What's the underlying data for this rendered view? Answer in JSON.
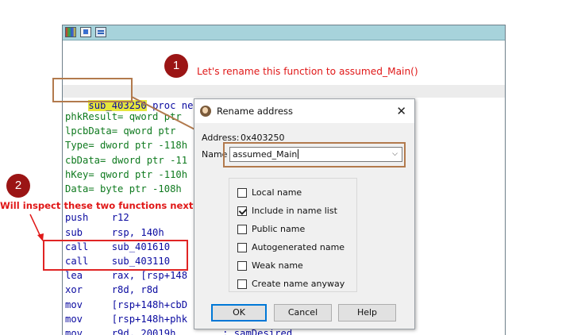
{
  "ida": {
    "function_name": "sub_403250",
    "proc_suffix": " proc near",
    "lines": [
      {
        "text": "phkResult= qword ptr ",
        "color": "green"
      },
      {
        "text": "lpcbData= qword ptr ",
        "color": "green"
      },
      {
        "text": "Type= dword ptr -118h",
        "color": "green"
      },
      {
        "text": "cbData= dword ptr -11",
        "color": "green"
      },
      {
        "text": "hKey= qword ptr -110h",
        "color": "green"
      },
      {
        "text": "Data= byte ptr -108h",
        "color": "green"
      },
      {
        "text": "",
        "color": "black"
      },
      {
        "text": "push    r12",
        "color": "blue"
      },
      {
        "text": "sub     rsp, 140h",
        "color": "blue"
      },
      {
        "text": "call    sub_401610",
        "color": "blue"
      },
      {
        "text": "call    sub_403110",
        "color": "blue"
      },
      {
        "text": "lea     rax, [rsp+148",
        "color": "blue"
      },
      {
        "text": "xor     r8d, r8d",
        "color": "blue"
      },
      {
        "text": "mov     [rsp+148h+cbD",
        "color": "blue"
      },
      {
        "text": "mov     [rsp+148h+phk",
        "color": "blue"
      },
      {
        "text": "mov     r9d, 20019h        ; samDesired",
        "color": "blue"
      }
    ]
  },
  "annotations": {
    "badge1": "1",
    "note1": "Let's rename this function to assumed_Main()",
    "badge2": "2",
    "note2": "Will inspect these two functions next"
  },
  "dialog": {
    "title": "Rename address",
    "close": "✕",
    "address_label": "Address:",
    "address_value": "0x403250",
    "name_label": "Name",
    "name_value": "assumed_Main",
    "options": [
      {
        "label": "Local name",
        "checked": false
      },
      {
        "label": "Include in name list",
        "checked": true
      },
      {
        "label": "Public name",
        "checked": false
      },
      {
        "label": "Autogenerated name",
        "checked": false
      },
      {
        "label": "Weak name",
        "checked": false
      },
      {
        "label": "Create name anyway",
        "checked": false
      }
    ],
    "buttons": {
      "ok": "OK",
      "cancel": "Cancel",
      "help": "Help"
    }
  },
  "colors": {
    "highlight_yellow": "#e6e63c",
    "annotation_red": "#e01818",
    "box_brown": "#b27a4d",
    "badge_dark_red": "#9b1515",
    "titlebar_teal": "#a7d3db"
  }
}
